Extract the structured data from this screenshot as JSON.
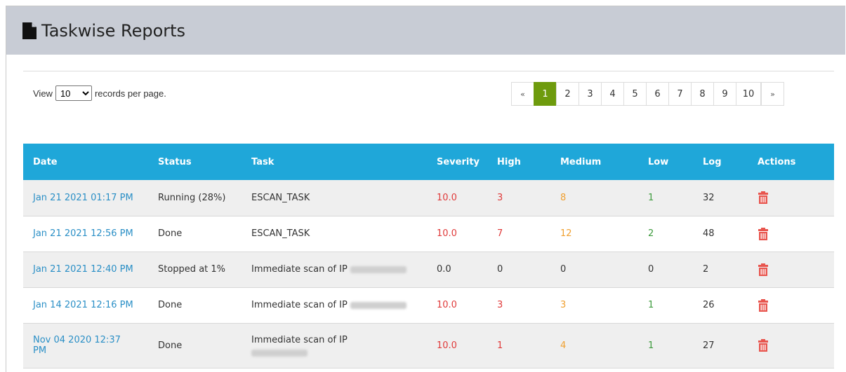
{
  "header": {
    "title": "Taskwise Reports",
    "icon": "file-icon"
  },
  "records_per_page": {
    "prefix": "View",
    "selected": "10",
    "suffix": "records per page."
  },
  "pagination": {
    "prev": "«",
    "pages": [
      "1",
      "2",
      "3",
      "4",
      "5",
      "6",
      "7",
      "8",
      "9",
      "10"
    ],
    "next": "»",
    "active_page": "1"
  },
  "table": {
    "columns": [
      "Date",
      "Status",
      "Task",
      "Severity",
      "High",
      "Medium",
      "Low",
      "Log",
      "Actions"
    ],
    "rows": [
      {
        "date": "Jan 21 2021 01:17 PM",
        "status": "Running (28%)",
        "task": "ESCAN_TASK",
        "severity": "10.0",
        "high": "3",
        "medium": "8",
        "low": "1",
        "log": "32"
      },
      {
        "date": "Jan 21 2021 12:56 PM",
        "status": "Done",
        "task": "ESCAN_TASK",
        "severity": "10.0",
        "high": "7",
        "medium": "12",
        "low": "2",
        "log": "48"
      },
      {
        "date": "Jan 21 2021 12:40 PM",
        "status": "Stopped at 1%",
        "task": "Immediate scan of IP",
        "severity": "0.0",
        "high": "0",
        "medium": "0",
        "low": "0",
        "log": "2"
      },
      {
        "date": "Jan 14 2021 12:16 PM",
        "status": "Done",
        "task": "Immediate scan of IP",
        "severity": "10.0",
        "high": "3",
        "medium": "3",
        "low": "1",
        "log": "26"
      },
      {
        "date": "Nov 04 2020 12:37 PM",
        "status": "Done",
        "task": "Immediate scan of IP",
        "severity": "10.0",
        "high": "1",
        "medium": "4",
        "low": "1",
        "log": "27"
      }
    ]
  },
  "colors": {
    "header_bg": "#c8ccd5",
    "table_header_bg": "#1fa7d9",
    "active_page_bg": "#6e9b0d",
    "date_link": "#2a8fc6",
    "high": "#e03a3a",
    "medium": "#f0a030",
    "low": "#3c9a3c",
    "delete_icon": "#e8554e"
  }
}
